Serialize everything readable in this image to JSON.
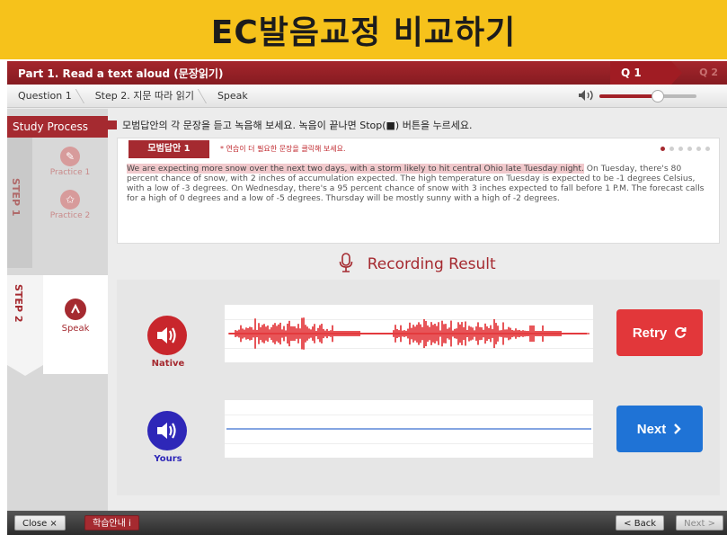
{
  "banner": {
    "title": "EC발음교정 비교하기"
  },
  "titlebar": {
    "title": "Part 1. Read a text aloud (문장읽기)",
    "q1": "Q 1",
    "q2": "Q 2"
  },
  "breadcrumb": {
    "items": [
      "Question 1",
      "Step 2. 지문 따라 읽기",
      "Speak"
    ]
  },
  "volume": {
    "icon": "speaker-volume-icon",
    "level": 0.6
  },
  "sidebar": {
    "header": "Study Process",
    "step1": "STEP 1",
    "step2": "STEP 2",
    "practice1": "Practice 1",
    "practice2": "Practice 2",
    "speak": "Speak"
  },
  "instruction": "모범답안의 각 문장을 듣고 녹음해 보세요. 녹음이 끝나면 Stop(■) 버튼을 누르세요.",
  "model": {
    "tab": "모범답안 1",
    "note": "* 연습이 더 필요한 문장을 클릭해 보세요.",
    "highlighted": "We are expecting more snow over the next two days, with a storm likely to hit central Ohio late Tuesday night.",
    "rest": " On Tuesday, there's 80 percent chance of snow, with 2 inches of accumulation expected. The high temperature on Tuesday is expected to be -1 degrees Celsius, with a low of -3 degrees. On Wednesday, there's a 95 percent chance of snow with 3 inches expected to fall before 1 P.M. The forecast calls for a high of 0 degrees and a low of -5 degrees. Thursday will be mostly sunny with a high of -2 degrees.",
    "dots_total": 6,
    "dots_active": 1
  },
  "recording": {
    "title": "Recording Result",
    "native_label": "Native",
    "yours_label": "Yours",
    "retry": "Retry",
    "next": "Next",
    "colors": {
      "native": "#e12a2e",
      "yours": "#3a6fd0",
      "retry": "#e2373a",
      "next": "#1f73d6"
    }
  },
  "footer": {
    "close": "Close ×",
    "guide": "학습안내 i",
    "back": "< Back",
    "next": "Next >"
  }
}
